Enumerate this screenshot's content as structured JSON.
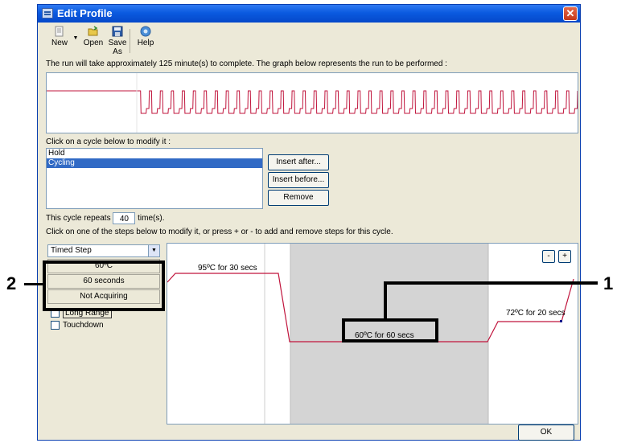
{
  "window": {
    "title": "Edit Profile",
    "close_glyph": "✕"
  },
  "toolbar": {
    "buttons": [
      {
        "label": "New",
        "icon": "new-icon"
      },
      {
        "label": "Open",
        "icon": "open-folder-icon"
      },
      {
        "label": "Save As",
        "icon": "save-icon"
      },
      {
        "label": "Help",
        "icon": "help-icon"
      }
    ]
  },
  "info_text": "The run will take approximately 125 minute(s) to complete. The graph below represents the run to be performed :",
  "cycle_section": {
    "label": "Click on a cycle below to modify it :",
    "items": [
      {
        "label": "Hold",
        "selected": false
      },
      {
        "label": "Cycling",
        "selected": true
      }
    ],
    "buttons": {
      "insert_after": "Insert after...",
      "insert_before": "Insert before...",
      "remove": "Remove"
    }
  },
  "repeat": {
    "prefix": "This cycle repeats",
    "value": "40",
    "suffix": "time(s)."
  },
  "steps_instruction": "Click on one of the steps below to modify it, or press + or - to add and remove steps for this cycle.",
  "step_panel": {
    "step_type": "Timed Step",
    "temperature": "60ºC",
    "duration": "60 seconds",
    "acquisition": "Not Acquiring",
    "options": [
      {
        "label": "Long Range",
        "checked": false
      },
      {
        "label": "Touchdown",
        "checked": false
      }
    ]
  },
  "step_graph": {
    "minus_label": "-",
    "plus_label": "+",
    "steps": [
      {
        "label": "95ºC for 30 secs",
        "selected": false
      },
      {
        "label": "60ºC for 60 secs",
        "selected": true
      },
      {
        "label": "72ºC for 20 secs",
        "selected": false
      }
    ]
  },
  "ok_label": "OK",
  "callouts": {
    "one": "1",
    "two": "2"
  },
  "colors": {
    "trace": "#c0143c",
    "selection": "#316ac5",
    "selected_step_bg": "#d4d4d4",
    "titlebar": "#0a5ae0"
  }
}
